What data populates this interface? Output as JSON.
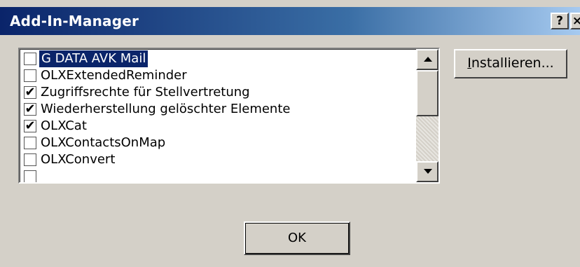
{
  "window": {
    "title": "Add-In-Manager",
    "help_glyph": "?",
    "close_glyph": "×"
  },
  "addins": {
    "items": [
      {
        "label": "G DATA AVK Mail",
        "checked": false,
        "selected": true
      },
      {
        "label": "OLXExtendedReminder",
        "checked": false,
        "selected": false
      },
      {
        "label": "Zugriffsrechte für Stellvertretung",
        "checked": true,
        "selected": false
      },
      {
        "label": "Wiederherstellung gelöschter Elemente",
        "checked": true,
        "selected": false
      },
      {
        "label": "OLXCat",
        "checked": true,
        "selected": false
      },
      {
        "label": "OLXContactsOnMap",
        "checked": false,
        "selected": false
      },
      {
        "label": "OLXConvert",
        "checked": false,
        "selected": false
      },
      {
        "label": "",
        "checked": false,
        "selected": false
      }
    ],
    "check_glyph": "✔",
    "scroll_up_icon": "triangle-up-icon",
    "scroll_down_icon": "triangle-down-icon"
  },
  "buttons": {
    "install_mnemonic": "I",
    "install_rest": "nstallieren...",
    "ok_label": "OK"
  },
  "colors": {
    "title_start": "#0a246a",
    "title_end": "#a6caf0",
    "face": "#d4d0c8",
    "selection": "#0a246a"
  }
}
